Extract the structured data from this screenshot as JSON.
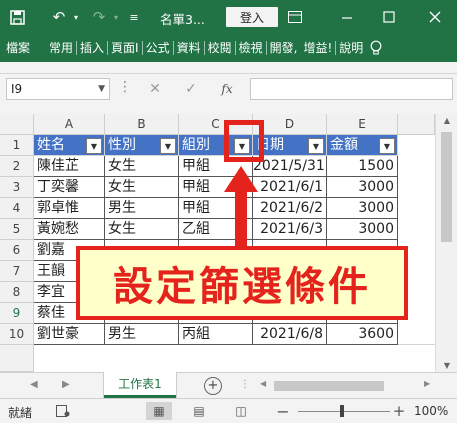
{
  "titlebar": {
    "filename": "名單3...",
    "sign_in": "登入",
    "colors": {
      "accent": "#217346"
    }
  },
  "ribbon": {
    "tabs": [
      "檔案",
      "常用",
      "插入",
      "頁面I",
      "公式",
      "資料",
      "校閱",
      "檢視",
      "開發,",
      "增益!",
      "說明"
    ]
  },
  "formula_bar": {
    "name_box": "I9",
    "fx_label": "fx",
    "value": ""
  },
  "sheet": {
    "columns": [
      "A",
      "B",
      "C",
      "D",
      "E"
    ],
    "rows": [
      "1",
      "2",
      "3",
      "4",
      "5",
      "6",
      "7",
      "8",
      "9",
      "10"
    ],
    "headers": [
      "姓名",
      "性別",
      "組別",
      "日期",
      "金額"
    ],
    "data": [
      [
        "陳佳芷",
        "女生",
        "甲組",
        "2021/5/31",
        "1500"
      ],
      [
        "丁奕馨",
        "女生",
        "甲組",
        "2021/6/1",
        "3000"
      ],
      [
        "郭卓惟",
        "男生",
        "甲組",
        "2021/6/2",
        "3000"
      ],
      [
        "黃婉愁",
        "女生",
        "乙組",
        "2021/6/3",
        "3000"
      ],
      [
        "劉嘉",
        "",
        "",
        "",
        ""
      ],
      [
        "王韻",
        "",
        "",
        "",
        ""
      ],
      [
        "李宜",
        "",
        "",
        "",
        ""
      ],
      [
        "蔡佳",
        "",
        "",
        "",
        ""
      ],
      [
        "劉世豪",
        "男生",
        "丙組",
        "2021/6/8",
        "3600"
      ]
    ],
    "header_color": "#4472c4"
  },
  "sheetbar": {
    "active_tab": "工作表1"
  },
  "status": {
    "ready": "就緒",
    "zoom": "100%"
  },
  "annotation": {
    "callout_text": "設定篩選條件",
    "color": "#e5231d"
  }
}
